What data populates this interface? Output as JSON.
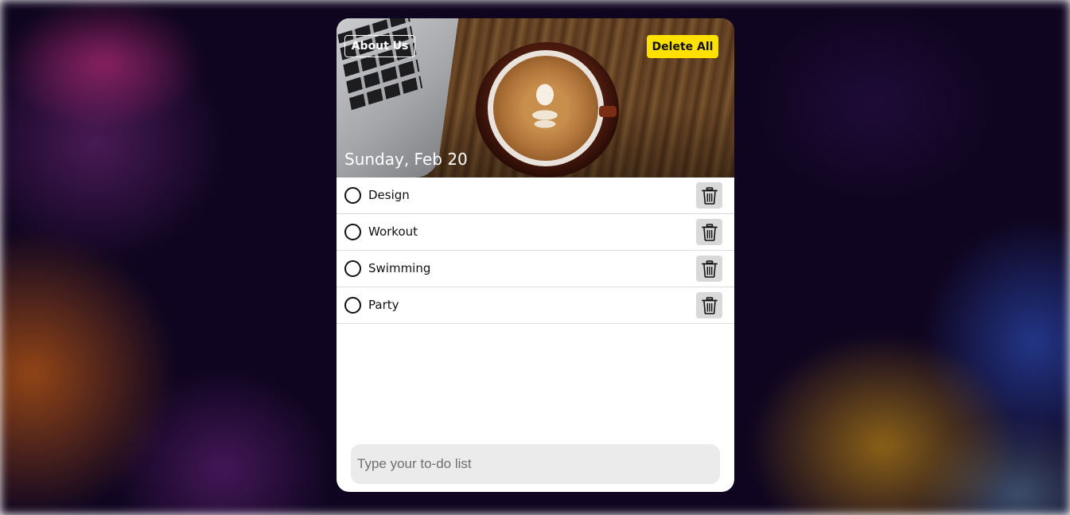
{
  "header": {
    "about_label": "About Us",
    "delete_all_label": "Delete All",
    "date": "Sunday, Feb 20",
    "delete_all_color": "#ffe100"
  },
  "todos": [
    {
      "label": "Design",
      "done": false
    },
    {
      "label": "Workout",
      "done": false
    },
    {
      "label": "Swimming",
      "done": false
    },
    {
      "label": "Party",
      "done": false
    }
  ],
  "input": {
    "value": "",
    "placeholder": "Type your to-do list"
  },
  "icons": {
    "toggle": "circle-outline-icon",
    "delete": "trash-icon"
  }
}
